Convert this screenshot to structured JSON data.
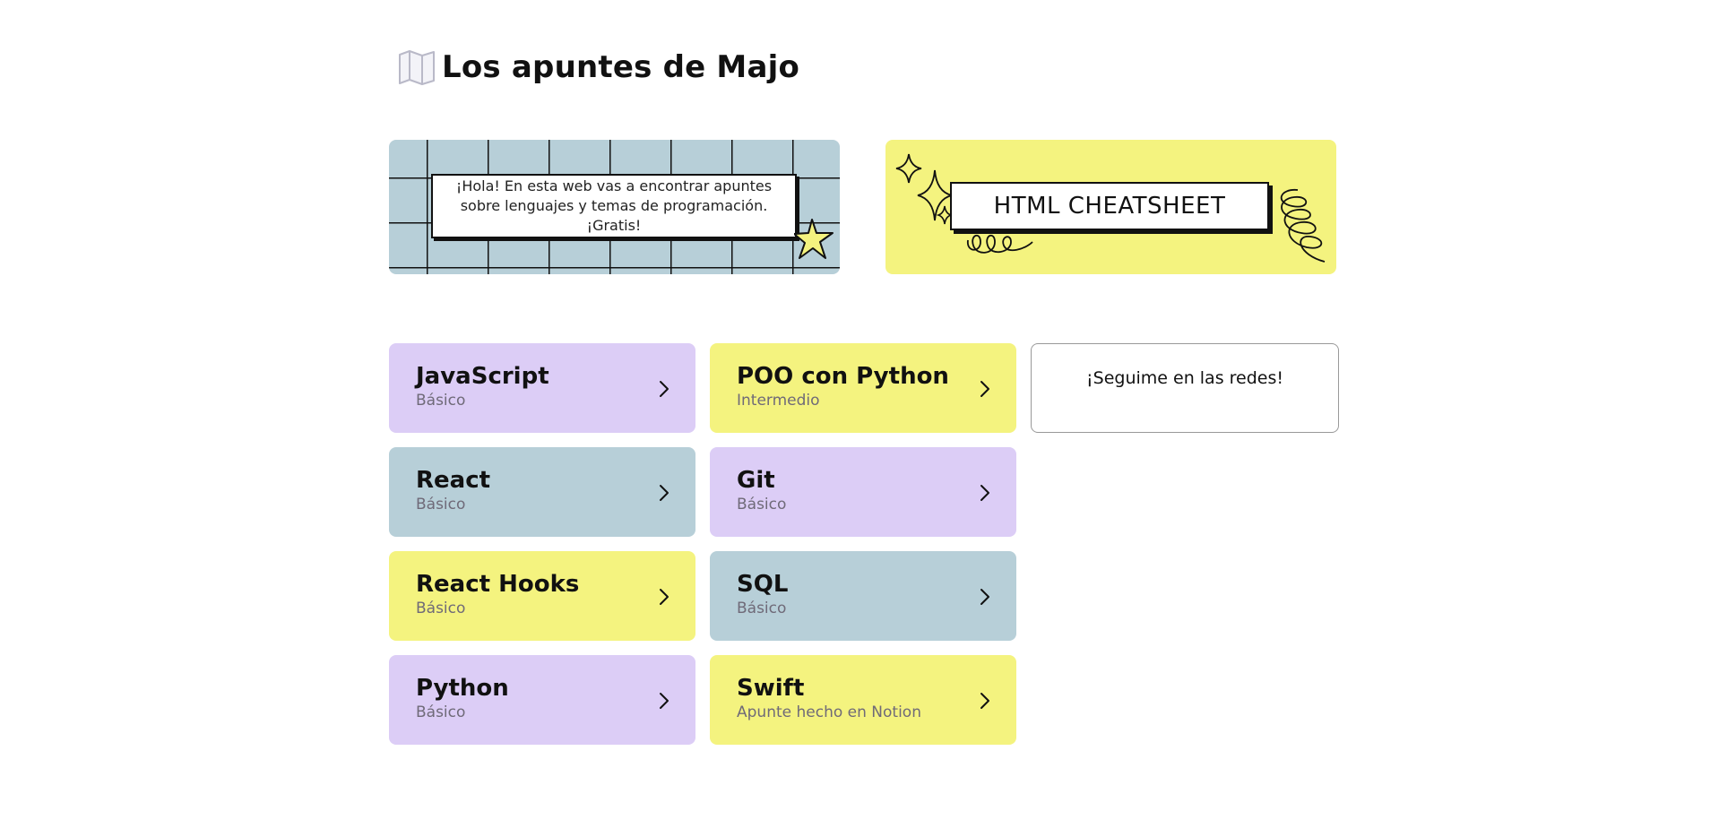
{
  "header": {
    "title": "Los apuntes de Majo",
    "logo_icon": "folded-map-icon"
  },
  "banners": {
    "intro_text": "¡Hola! En esta web vas a encontrar apuntes sobre lenguajes y temas de programación. ¡Gratis!",
    "cheatsheet_label": "HTML CHEATSHEET"
  },
  "cards": [
    {
      "title": "JavaScript",
      "subtitle": "Básico",
      "color": "#dccdf6"
    },
    {
      "title": "POO con Python",
      "subtitle": "Intermedio",
      "color": "#f4f37f"
    },
    {
      "title": "React",
      "subtitle": "Básico",
      "color": "#b7cfd8"
    },
    {
      "title": "Git",
      "subtitle": "Básico",
      "color": "#dccdf6"
    },
    {
      "title": "React Hooks",
      "subtitle": "Básico",
      "color": "#f4f37f"
    },
    {
      "title": "SQL",
      "subtitle": "Básico",
      "color": "#b7cfd8"
    },
    {
      "title": "Python",
      "subtitle": "Básico",
      "color": "#dccdf6"
    },
    {
      "title": "Swift",
      "subtitle": "Apunte hecho en Notion",
      "color": "#f4f37f"
    }
  ],
  "social": {
    "label": "¡Seguime en las redes!"
  },
  "icons": {
    "chevron": "chevron-right-icon",
    "star": "star-icon",
    "sparkles": "sparkles-icon",
    "scribble": "scribble-icon",
    "loops": "loops-icon"
  }
}
